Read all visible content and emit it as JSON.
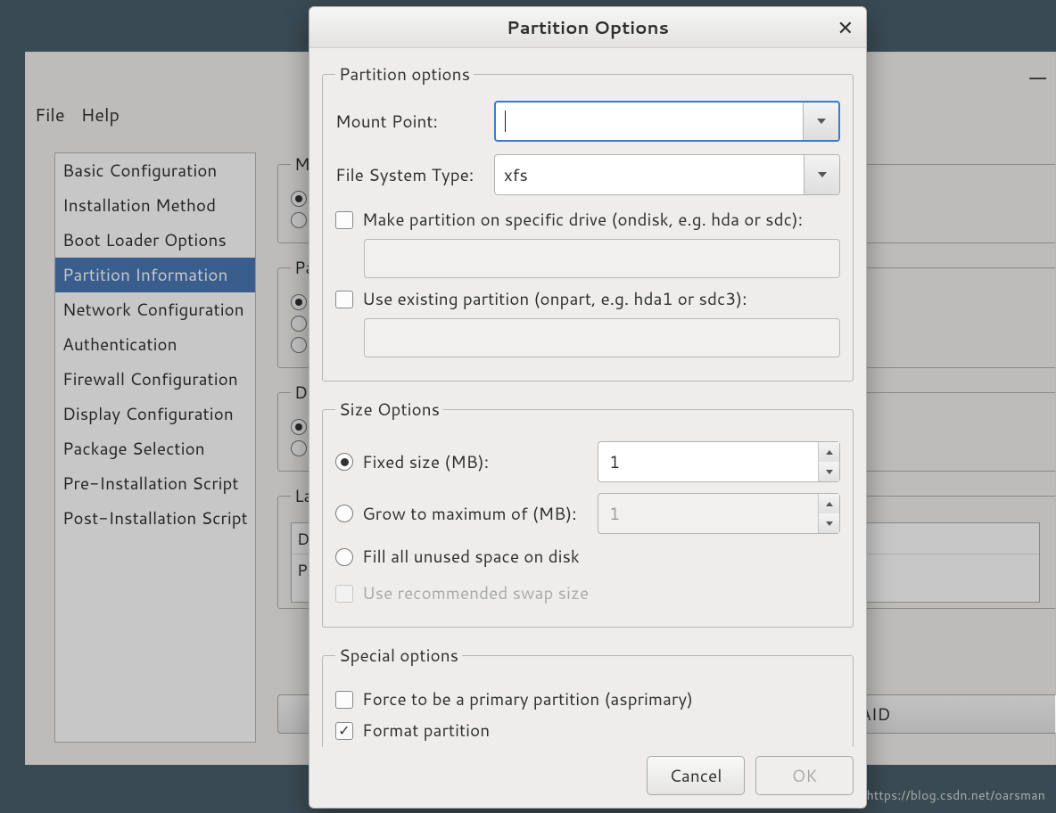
{
  "main_window": {
    "min_icon": "—",
    "menubar": {
      "file": "File",
      "help": "Help"
    },
    "sidebar": {
      "items": [
        "Basic Configuration",
        "Installation Method",
        "Boot Loader Options",
        "Partition Information",
        "Network Configuration",
        "Authentication",
        "Firewall Configuration",
        "Display Configuration",
        "Package Selection",
        "Pre-Installation Script",
        "Post-Installation Script"
      ],
      "selected_index": 3
    },
    "bg_groups": [
      "Mas",
      "Par",
      "Dis",
      "Lay"
    ],
    "bg_table_cols": [
      "D",
      "P"
    ],
    "buttons": {
      "raid": "RAID"
    }
  },
  "dialog": {
    "title": "Partition Options",
    "close": "✕",
    "partition_options": {
      "legend": "Partition options",
      "mount_point_label": "Mount Point:",
      "mount_point_value": "",
      "fs_type_label": "File System Type:",
      "fs_type_value": "xfs",
      "ondisk_label": "Make partition on specific drive (ondisk, e.g. hda or sdc):",
      "ondisk_checked": false,
      "ondisk_value": "",
      "onpart_label": "Use existing partition (onpart, e.g. hda1 or sdc3):",
      "onpart_checked": false,
      "onpart_value": ""
    },
    "size_options": {
      "legend": "Size Options",
      "fixed_label": "Fixed size (MB):",
      "fixed_value": "1",
      "grow_label": "Grow to maximum of (MB):",
      "grow_value": "1",
      "fill_label": "Fill all unused space on disk",
      "swap_label": "Use recommended swap size",
      "selected": "fixed"
    },
    "special_options": {
      "legend": "Special options",
      "asprimary_label": "Force to be a primary partition (asprimary)",
      "asprimary_checked": false,
      "format_label": "Format partition",
      "format_checked": true
    },
    "buttons": {
      "cancel": "Cancel",
      "ok": "OK"
    }
  },
  "watermark": "https://blog.csdn.net/oarsman"
}
